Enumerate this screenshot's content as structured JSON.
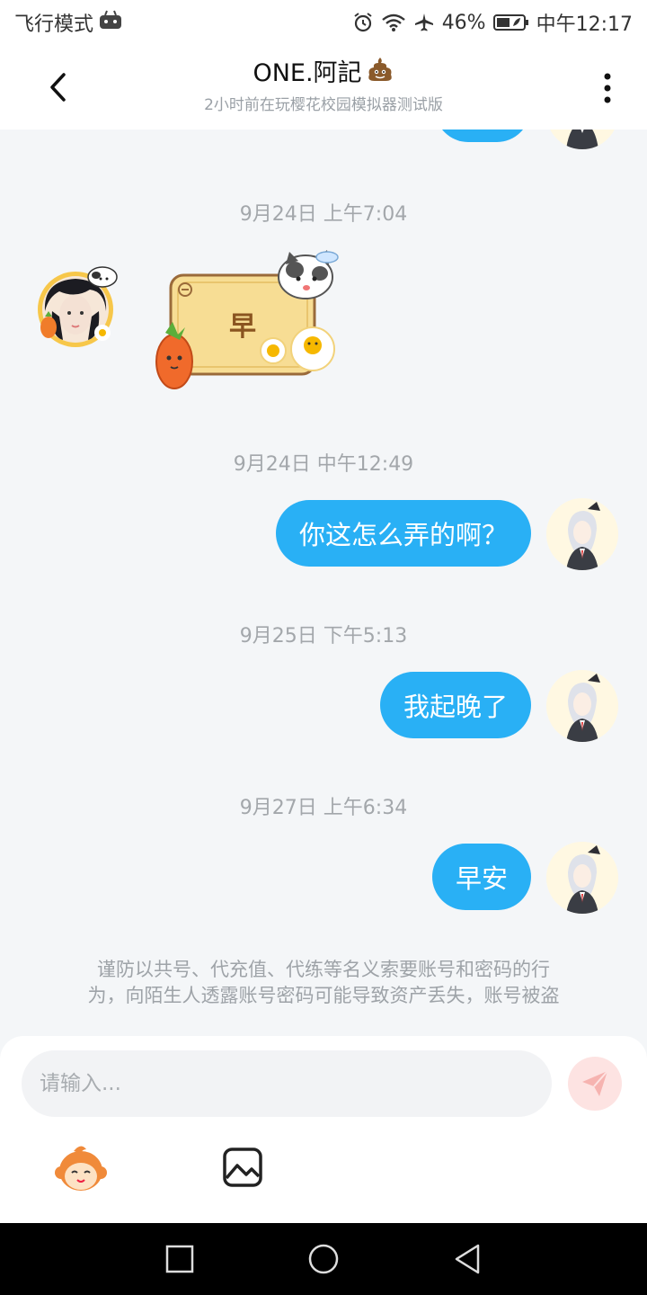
{
  "status_bar": {
    "left_text": "飞行模式",
    "battery": "46%",
    "time": "中午12:17",
    "icons": [
      "gamepad-icon",
      "alarm-icon",
      "wifi-icon",
      "airplane-icon",
      "battery-icon"
    ]
  },
  "header": {
    "back_icon": "chevron-left-icon",
    "name": "ONE.阿記",
    "name_emoji": "💩",
    "subtitle": "2小时前在玩樱花校园模拟器测试版",
    "more_icon": "more-vertical-icon"
  },
  "messages": [
    {
      "timestamp": "9月24日 上午7:04",
      "sender": "peer",
      "type": "sticker",
      "sticker_text": "早"
    },
    {
      "timestamp": "9月24日 中午12:49",
      "sender": "me",
      "type": "text",
      "text": "你这怎么弄的啊？"
    },
    {
      "timestamp": "9月25日 下午5:13",
      "sender": "me",
      "type": "text",
      "text": "我起晚了"
    },
    {
      "timestamp": "9月27日 上午6:34",
      "sender": "me",
      "type": "text",
      "text": "早安"
    }
  ],
  "warning": {
    "line1": "谨防以共号、代充值、代练等名义索要账号和密码的行",
    "line2": "为，向陌生人透露账号密码可能导致资产丢失，账号被盗"
  },
  "composer": {
    "placeholder": "请输入...",
    "send_icon": "send-icon",
    "emoji_icon": "monkey-emoji-icon",
    "image_icon": "image-icon"
  },
  "colors": {
    "bubble": "#29b0f5",
    "background": "#f4f6f8",
    "send_button": "#fde3e2"
  }
}
